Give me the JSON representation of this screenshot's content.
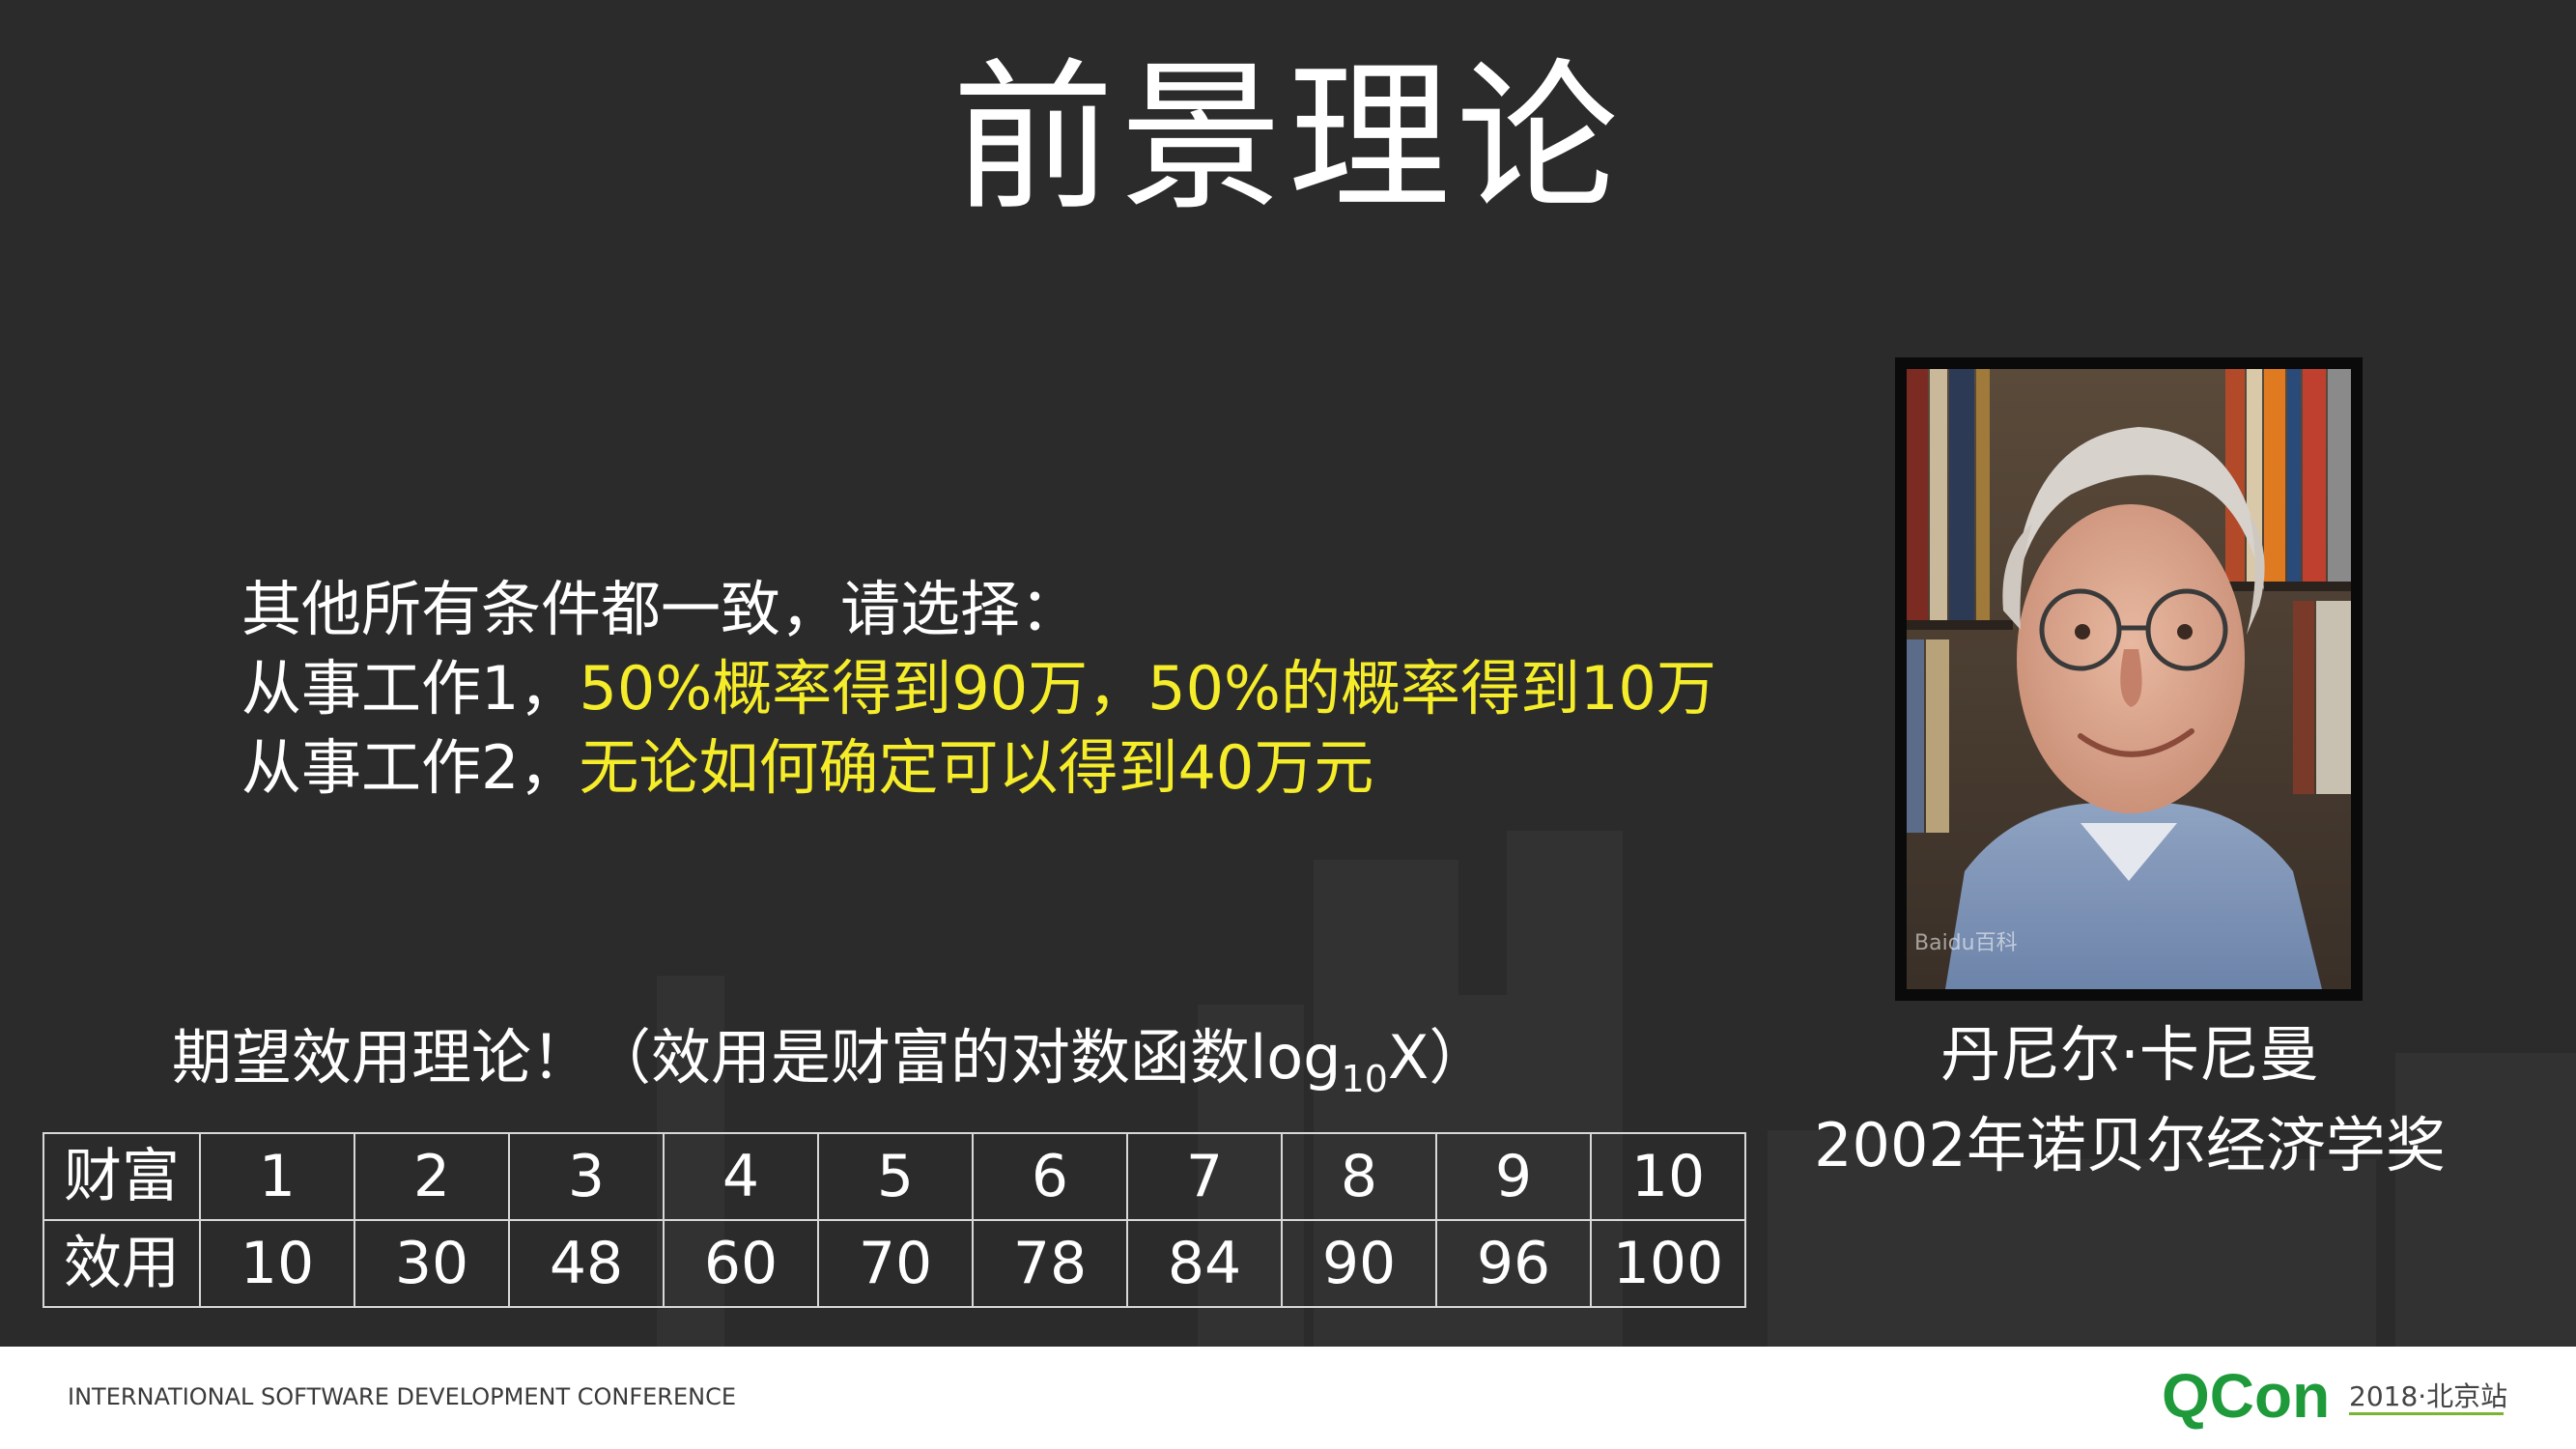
{
  "slide": {
    "title": "前景理论",
    "question": {
      "line1": "其他所有条件都一致，请选择：",
      "line2_prefix": "从事工作1，",
      "line2_highlight": "50%概率得到90万，50%的概率得到10万",
      "line3_prefix": "从事工作2，",
      "line3_highlight": "无论如何确定可以得到40万元"
    },
    "photo": {
      "watermark": "Baidu百科"
    },
    "caption": {
      "name": "丹尼尔·卡尼曼",
      "award": "2002年诺贝尔经济学奖"
    },
    "expected_utility": {
      "title_main": "期望效用理论！（效用是财富的对数函数log",
      "title_sub": "10",
      "title_end": "X）",
      "row_headers": [
        "财富",
        "效用"
      ],
      "wealth": [
        "1",
        "2",
        "3",
        "4",
        "5",
        "6",
        "7",
        "8",
        "9",
        "10"
      ],
      "utility": [
        "10",
        "30",
        "48",
        "60",
        "70",
        "78",
        "84",
        "90",
        "96",
        "100"
      ]
    }
  },
  "footer": {
    "conference": "INTERNATIONAL SOFTWARE DEVELOPMENT CONFERENCE",
    "logo_text": "QCon",
    "logo_suffix": "2018·北京站",
    "brand_colors": {
      "green": "#1f9a3a",
      "blue": "#1b6fb6",
      "lime": "#7ab532"
    }
  },
  "colors": {
    "slide_bg": "#2b2b2b",
    "text": "#ffffff",
    "highlight": "#f5ec2a"
  }
}
